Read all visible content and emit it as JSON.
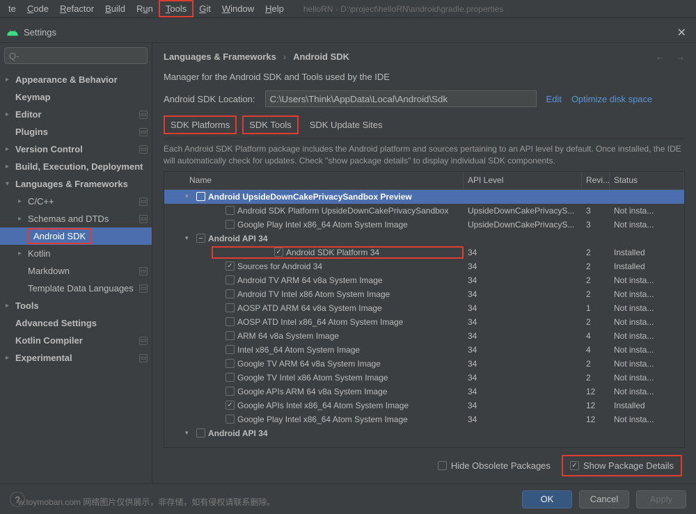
{
  "menubar": {
    "items": [
      {
        "label": "te"
      },
      {
        "label": "Code",
        "u": 0
      },
      {
        "label": "Refactor",
        "u": 0
      },
      {
        "label": "Build",
        "u": 0
      },
      {
        "label": "Run",
        "u": 1
      },
      {
        "label": "Tools",
        "u": 0,
        "highlight": true
      },
      {
        "label": "Git",
        "u": 0
      },
      {
        "label": "Window",
        "u": 0
      },
      {
        "label": "Help",
        "u": 0
      }
    ],
    "project_path": "helloRN - D:\\project\\helloRN\\android\\gradle.properties"
  },
  "settings": {
    "title": "Settings",
    "search_placeholder": "Q-",
    "tree": [
      {
        "label": "Appearance & Behavior",
        "bold": true,
        "arrow": ">"
      },
      {
        "label": "Keymap",
        "bold": true
      },
      {
        "label": "Editor",
        "bold": true,
        "arrow": ">",
        "badge": "▭"
      },
      {
        "label": "Plugins",
        "bold": true,
        "badge": "▭"
      },
      {
        "label": "Version Control",
        "bold": true,
        "arrow": ">",
        "badge": "▭"
      },
      {
        "label": "Build, Execution, Deployment",
        "bold": true,
        "arrow": ">"
      },
      {
        "label": "Languages & Frameworks",
        "bold": true,
        "arrow": "v"
      },
      {
        "label": "C/C++",
        "indent": 1,
        "arrow": ">",
        "badge": "▭"
      },
      {
        "label": "Schemas and DTDs",
        "indent": 1,
        "arrow": ">",
        "badge": "▭"
      },
      {
        "label": "Android SDK",
        "indent": 1,
        "selected": true,
        "highlight": true
      },
      {
        "label": "Kotlin",
        "indent": 1,
        "arrow": ">"
      },
      {
        "label": "Markdown",
        "indent": 1,
        "badge": "▭"
      },
      {
        "label": "Template Data Languages",
        "indent": 1,
        "badge": "▭"
      },
      {
        "label": "Tools",
        "bold": true,
        "arrow": ">"
      },
      {
        "label": "Advanced Settings",
        "bold": true
      },
      {
        "label": "Kotlin Compiler",
        "bold": true,
        "badge": "▭"
      },
      {
        "label": "Experimental",
        "bold": true,
        "arrow": ">",
        "badge": "▭"
      }
    ]
  },
  "main": {
    "breadcrumb": [
      "Languages & Frameworks",
      "Android SDK"
    ],
    "manager_desc": "Manager for the Android SDK and Tools used by the IDE",
    "location_label": "Android SDK Location:",
    "location_value": "C:\\Users\\Think\\AppData\\Local\\Android\\Sdk",
    "edit_link": "Edit",
    "optimize_link": "Optimize disk space",
    "tabs": [
      {
        "label": "SDK Platforms",
        "highlight": true
      },
      {
        "label": "SDK Tools",
        "highlight": true
      },
      {
        "label": "SDK Update Sites"
      }
    ],
    "desc": "Each Android SDK Platform package includes the Android platform and sources pertaining to an API level by default. Once installed, the IDE will automatically check for updates. Check \"show package details\" to display individual SDK components.",
    "columns": {
      "name": "Name",
      "api": "API Level",
      "rev": "Revi...",
      "status": "Status"
    },
    "rows": [
      {
        "name": "Android UpsideDownCakePrivacySandbox Preview",
        "api": "",
        "rev": "",
        "status": "",
        "bold": true,
        "arrow": "v",
        "cb": "empty",
        "indent": "a",
        "selected": true
      },
      {
        "name": "Android SDK Platform UpsideDownCakePrivacySandbox",
        "api": "UpsideDownCakePrivacyS...",
        "rev": "3",
        "status": "Not insta...",
        "cb": "empty",
        "indent": "c"
      },
      {
        "name": "Google Play Intel x86_64 Atom System Image",
        "api": "UpsideDownCakePrivacyS...",
        "rev": "3",
        "status": "Not insta...",
        "cb": "empty",
        "indent": "c"
      },
      {
        "name": "Android API 34",
        "api": "",
        "rev": "",
        "status": "",
        "bold": true,
        "arrow": "v",
        "cb": "minus",
        "indent": "a"
      },
      {
        "name": "Android SDK Platform 34",
        "api": "34",
        "rev": "2",
        "status": "Installed",
        "cb": "checked",
        "indent": "c",
        "highlight": true
      },
      {
        "name": "Sources for Android 34",
        "api": "34",
        "rev": "2",
        "status": "Installed",
        "cb": "checked",
        "indent": "c"
      },
      {
        "name": "Android TV ARM 64 v8a System Image",
        "api": "34",
        "rev": "2",
        "status": "Not insta...",
        "cb": "empty",
        "indent": "c"
      },
      {
        "name": "Android TV Intel x86 Atom System Image",
        "api": "34",
        "rev": "2",
        "status": "Not insta...",
        "cb": "empty",
        "indent": "c"
      },
      {
        "name": "AOSP ATD ARM 64 v8a System Image",
        "api": "34",
        "rev": "1",
        "status": "Not insta...",
        "cb": "empty",
        "indent": "c"
      },
      {
        "name": "AOSP ATD Intel x86_64 Atom System Image",
        "api": "34",
        "rev": "2",
        "status": "Not insta...",
        "cb": "empty",
        "indent": "c"
      },
      {
        "name": "ARM 64 v8a System Image",
        "api": "34",
        "rev": "4",
        "status": "Not insta...",
        "cb": "empty",
        "indent": "c"
      },
      {
        "name": "Intel x86_64 Atom System Image",
        "api": "34",
        "rev": "4",
        "status": "Not insta...",
        "cb": "empty",
        "indent": "c"
      },
      {
        "name": "Google TV ARM 64 v8a System Image",
        "api": "34",
        "rev": "2",
        "status": "Not insta...",
        "cb": "empty",
        "indent": "c"
      },
      {
        "name": "Google TV Intel x86 Atom System Image",
        "api": "34",
        "rev": "2",
        "status": "Not insta...",
        "cb": "empty",
        "indent": "c"
      },
      {
        "name": "Google APIs ARM 64 v8a System Image",
        "api": "34",
        "rev": "12",
        "status": "Not insta...",
        "cb": "empty",
        "indent": "c"
      },
      {
        "name": "Google APIs Intel x86_64 Atom System Image",
        "api": "34",
        "rev": "12",
        "status": "Installed",
        "cb": "checked",
        "indent": "c"
      },
      {
        "name": "Google Play Intel x86_64 Atom System Image",
        "api": "34",
        "rev": "12",
        "status": "Not insta...",
        "cb": "empty",
        "indent": "c"
      },
      {
        "name": "Android API 34",
        "api": "",
        "rev": "",
        "status": "",
        "bold": true,
        "arrow": "v",
        "cb": "empty",
        "indent": "a"
      }
    ],
    "hide_obsolete": {
      "label": "Hide Obsolete Packages",
      "checked": false
    },
    "show_details": {
      "label": "Show Package Details",
      "checked": true,
      "highlight": true
    }
  },
  "buttons": {
    "ok": "OK",
    "cancel": "Cancel",
    "apply": "Apply"
  },
  "watermark": "w.toymoban.com 网络图片仅供展示，非存储，如有侵权请联系删除。"
}
